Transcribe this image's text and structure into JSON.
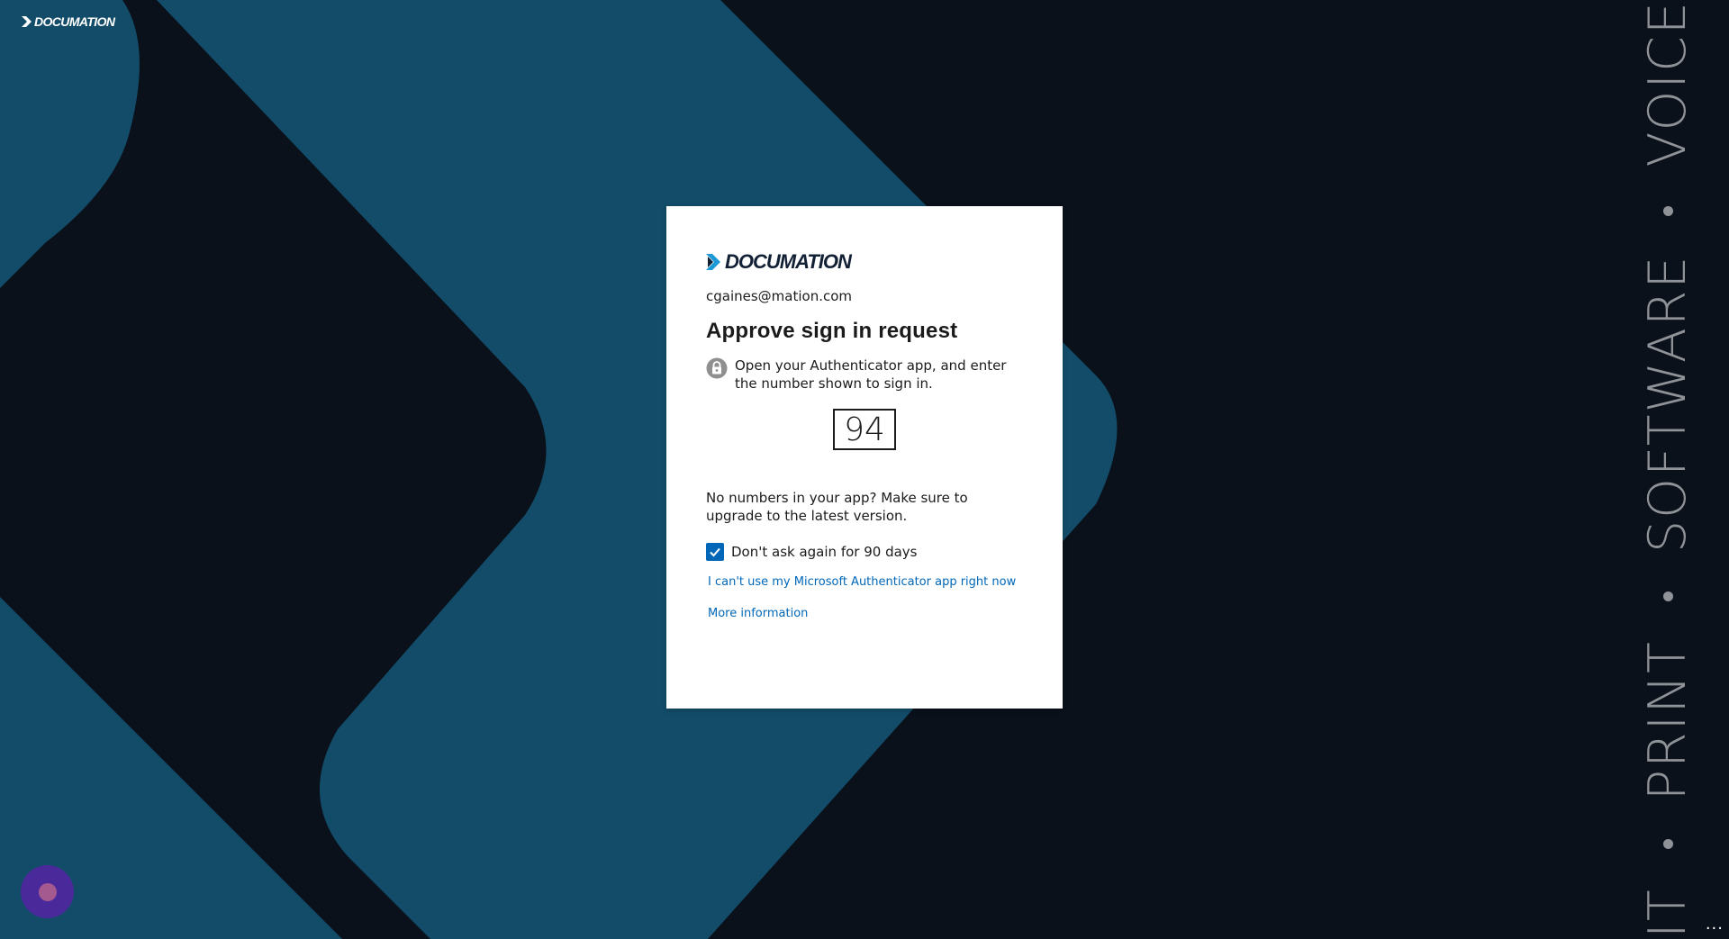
{
  "brand": {
    "logo_text": "DOCUMATION",
    "colors": {
      "navy": "#122035",
      "accent": "#1d9ad6",
      "teal": "#124c69",
      "dark": "#0a111b"
    }
  },
  "slogan": {
    "items": [
      "IT",
      "PRINT",
      "SOFTWARE",
      "VOICE"
    ]
  },
  "card": {
    "email": "cgaines@mation.com",
    "title": "Approve sign in request",
    "instruction": "Open your Authenticator app, and enter the number shown to sign in.",
    "number": "94",
    "no_numbers_text": "No numbers in your app? Make sure to upgrade to the latest version.",
    "checkbox": {
      "label": "Don't ask again for 90 days",
      "checked": true,
      "color": "#0067b8"
    },
    "cant_use_link": "I can't use my Microsoft Authenticator app right now",
    "more_info_link": "More information",
    "icons": {
      "lock": "lock-icon",
      "check": "checkmark-icon"
    }
  },
  "footer": {
    "ellipsis": "..."
  },
  "chat": {
    "icon": "chat-launcher-icon",
    "color": "#4a2a9b"
  }
}
